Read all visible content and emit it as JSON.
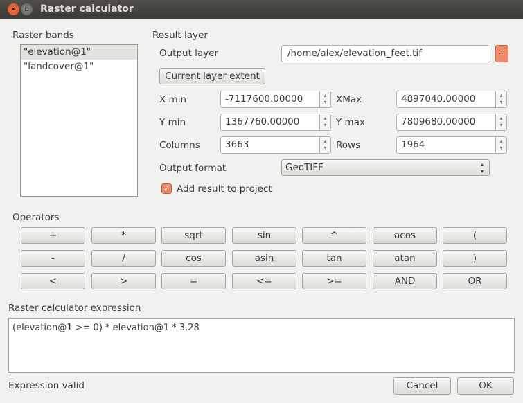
{
  "window": {
    "title": "Raster calculator"
  },
  "raster_bands": {
    "label": "Raster bands",
    "items": [
      "\"elevation@1\"",
      "\"landcover@1\""
    ],
    "selected": 0
  },
  "result_layer": {
    "label": "Result layer",
    "output_layer_label": "Output layer",
    "output_layer_value": "/home/alex/elevation_feet.tif",
    "browse_label": "...",
    "current_extent_label": "Current layer extent",
    "xmin_label": "X min",
    "xmin": "-7117600.00000",
    "xmax_label": "XMax",
    "xmax": "4897040.00000",
    "ymin_label": "Y min",
    "ymin": "1367760.00000",
    "ymax_label": "Y max",
    "ymax": "7809680.00000",
    "columns_label": "Columns",
    "columns": "3663",
    "rows_label": "Rows",
    "rows": "1964",
    "format_label": "Output format",
    "format": "GeoTIFF",
    "add_result_label": "Add result to project",
    "add_result_checked": true
  },
  "operators": {
    "label": "Operators",
    "rows": [
      [
        "+",
        "*",
        "sqrt",
        "sin",
        "^",
        "acos",
        "("
      ],
      [
        "-",
        "/",
        "cos",
        "asin",
        "tan",
        "atan",
        ")"
      ],
      [
        "<",
        ">",
        "=",
        "<=",
        ">=",
        "AND",
        "OR"
      ]
    ]
  },
  "expression": {
    "label": "Raster calculator expression",
    "value": "(elevation@1 >= 0) * elevation@1 * 3.28",
    "status": "Expression valid"
  },
  "buttons": {
    "cancel": "Cancel",
    "ok": "OK"
  },
  "colors": {
    "accent": "#f0896a",
    "titlebar": "#3c3b37"
  }
}
